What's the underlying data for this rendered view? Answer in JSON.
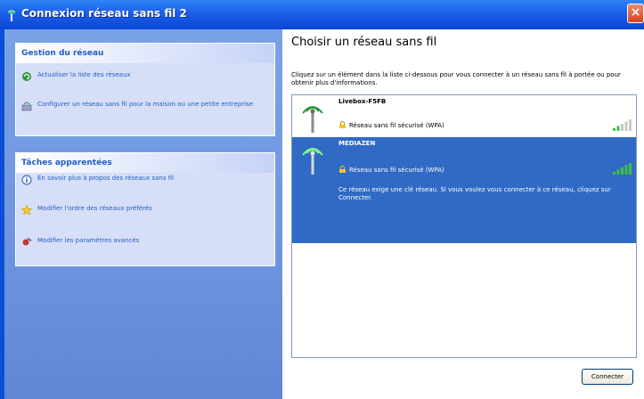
{
  "window": {
    "title": "Connexion réseau sans fil 2",
    "close_label": "×"
  },
  "left": {
    "network_tasks": {
      "heading": "Gestion du réseau",
      "items": [
        {
          "label": "Actualiser la liste des réseaux",
          "icon": "refresh-icon"
        },
        {
          "label": "Configurer un réseau sans fil pour la maison ou une petite entreprise",
          "icon": "network-setup-icon"
        }
      ]
    },
    "related_tasks": {
      "heading": "Tâches apparentées",
      "items": [
        {
          "label": "En savoir plus à propos des réseaux sans fil",
          "icon": "info-icon"
        },
        {
          "label": "Modifier l'ordre des réseaux préférés",
          "icon": "star-icon"
        },
        {
          "label": "Modifier les paramètres avancés",
          "icon": "advanced-settings-icon"
        }
      ]
    }
  },
  "right": {
    "title": "Choisir un réseau sans fil",
    "description": "Cliquez sur un élément dans la liste ci-dessous pour vous connecter à un réseau sans fil à portée ou pour obtenir plus d'informations.",
    "networks": [
      {
        "name": "Livebox-F5FB",
        "status": "Réseau sans fil sécurisé (WPA)",
        "signal_bars": 2,
        "selected": false
      },
      {
        "name": "MEDIAZEN",
        "status": "Réseau sans fil sécurisé (WPA)",
        "signal_bars": 5,
        "selected": true,
        "info": "Ce réseau exige une clé réseau. Si vous voulez vous connecter à ce réseau, cliquez sur Connecter."
      }
    ],
    "connect_label": "Connecter"
  },
  "colors": {
    "titlebar": "#1c5fe8",
    "selection": "#316ac5",
    "task_link": "#215dc6",
    "signal_green": "#3ec43e"
  }
}
